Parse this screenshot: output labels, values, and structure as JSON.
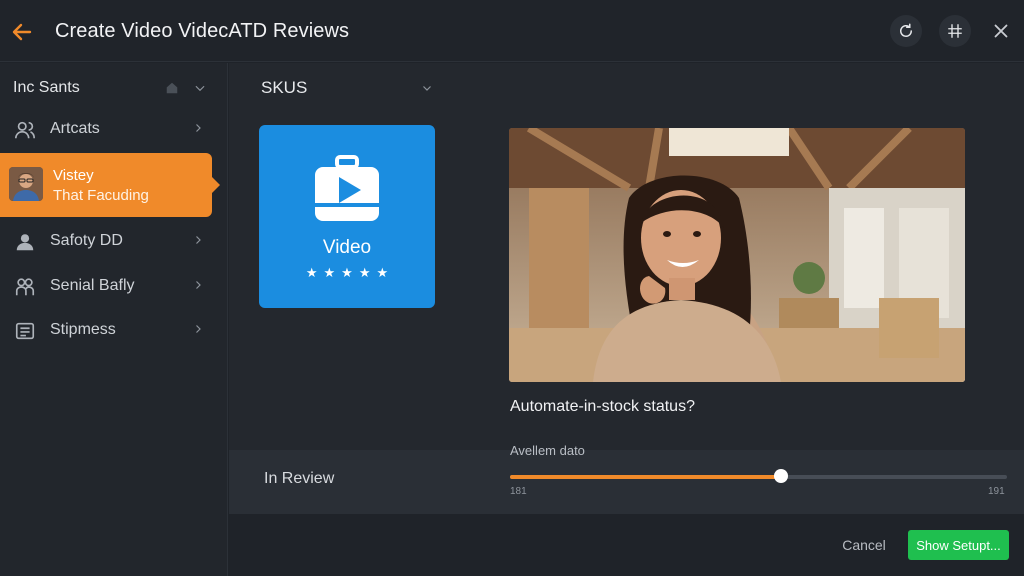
{
  "header": {
    "title": "Create Video VidecATD Reviews"
  },
  "sidebar": {
    "heading": "Inc Sants",
    "items": [
      {
        "label": "Artcats",
        "icon": "users-icon"
      },
      {
        "label": "Safoty DD",
        "icon": "person-icon"
      },
      {
        "label": "Senial Bafly",
        "icon": "group-icon"
      },
      {
        "label": "Stipmess",
        "icon": "list-icon"
      }
    ],
    "active": {
      "title": "Vistey",
      "subtitle": "That Facuding"
    }
  },
  "main": {
    "skus_label": "SKUS",
    "video_card": {
      "label": "Video",
      "stars": "★★★★★"
    },
    "question": "Automate-in-stock status?",
    "review_label": "In Review",
    "slider": {
      "label": "Avellem dato",
      "min_label": "181",
      "max_label": "191",
      "value_fraction": 0.545
    }
  },
  "footer": {
    "cancel_label": "Cancel",
    "primary_label": "Show Setupt..."
  },
  "colors": {
    "accent": "#f08a2a",
    "video_card": "#1b8de0",
    "primary_button": "#1fbf4f",
    "background": "#1f2329"
  }
}
